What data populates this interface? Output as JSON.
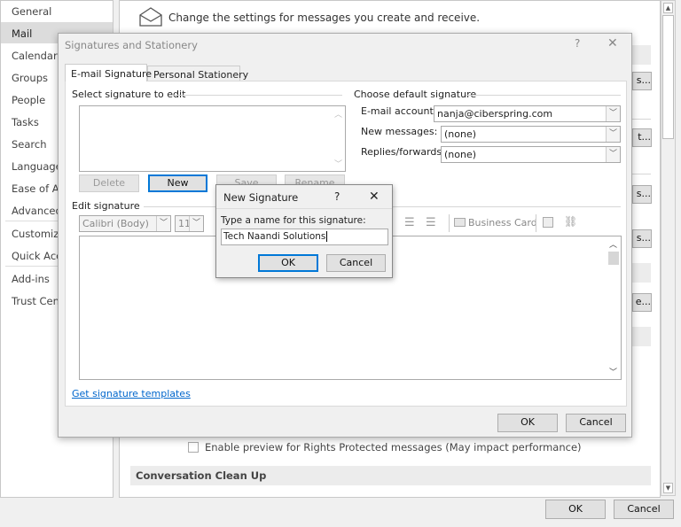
{
  "options": {
    "nav": [
      "General",
      "Mail",
      "Calendar",
      "Groups",
      "People",
      "Tasks",
      "Search",
      "Language",
      "Ease of Acc",
      "Advanced",
      "Customize",
      "Quick Acce",
      "Add-ins",
      "Trust Cente"
    ],
    "selected_nav": "Mail",
    "header_text": "Change the settings for messages you create and receive.",
    "right_buttons": [
      "s...",
      "t...",
      "s...",
      "s...",
      "e..."
    ],
    "rights_checkbox": "Enable preview for Rights Protected messages (May impact performance)",
    "section_conversation": "Conversation Clean Up",
    "ok": "OK",
    "cancel": "Cancel"
  },
  "sig_dialog": {
    "title": "Signatures and Stationery",
    "help": "?",
    "close": "✕",
    "tabs": [
      "E-mail Signature",
      "Personal Stationery"
    ],
    "select_label": "Select signature to edit",
    "buttons": {
      "delete": "Delete",
      "new": "New",
      "save": "Save",
      "rename": "Rename"
    },
    "default_label": "Choose default signature",
    "email_account_label": "E-mail account:",
    "email_account": "nanja@ciberspring.com",
    "new_messages_label": "New messages:",
    "new_messages": "(none)",
    "replies_label": "Replies/forwards:",
    "replies": "(none)",
    "edit_label": "Edit signature",
    "font": "Calibri (Body)",
    "size": "11",
    "business_card": "Business Card",
    "templates_link": "Get signature templates",
    "ok": "OK",
    "cancel": "Cancel"
  },
  "new_sig": {
    "title": "New Signature",
    "help": "?",
    "close": "✕",
    "label": "Type a name for this signature:",
    "value": "Tech Naandi Solutions",
    "ok": "OK",
    "cancel": "Cancel"
  }
}
